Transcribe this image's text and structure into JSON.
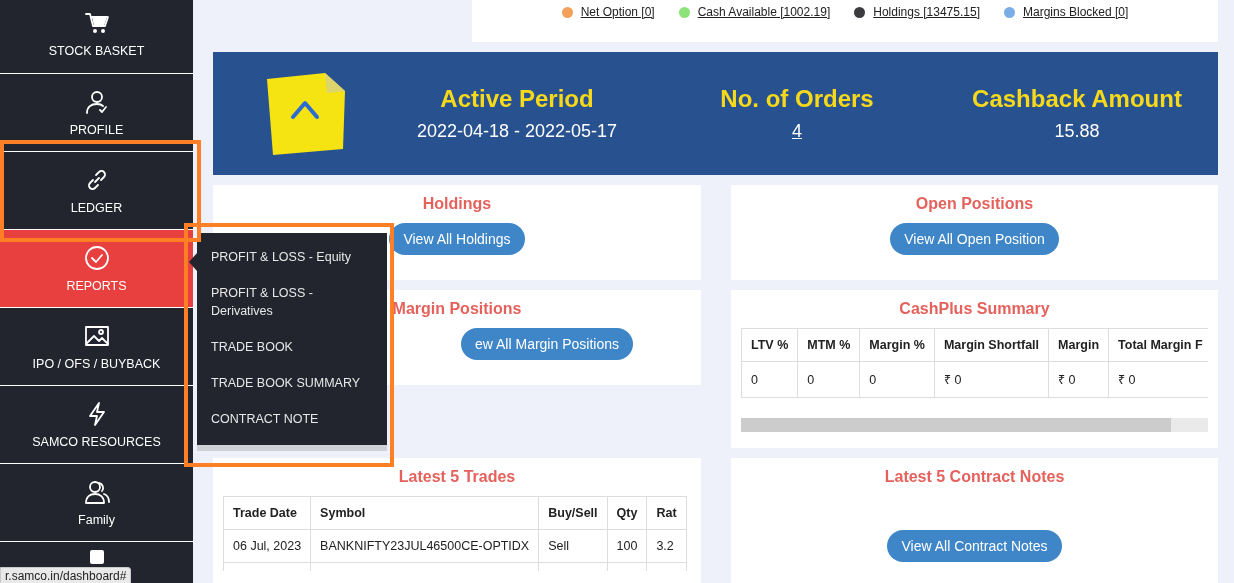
{
  "sidebar": {
    "items": [
      {
        "label": "STOCK BASKET",
        "selected": false
      },
      {
        "label": "PROFILE",
        "selected": false
      },
      {
        "label": "LEDGER",
        "selected": false
      },
      {
        "label": "REPORTS",
        "selected": true
      },
      {
        "label": "IPO / OFS / BUYBACK",
        "selected": false
      },
      {
        "label": "SAMCO RESOURCES",
        "selected": false
      },
      {
        "label": "Family",
        "selected": false
      },
      {
        "selected": false
      }
    ]
  },
  "reports_menu": {
    "items": [
      "PROFIT & LOSS - Equity",
      "PROFIT & LOSS - Derivatives",
      "TRADE BOOK",
      "TRADE BOOK SUMMARY",
      "CONTRACT NOTE"
    ]
  },
  "legend": [
    {
      "label": "Net Option [0]",
      "color": "#f5a05a"
    },
    {
      "label": "Cash Available [1002.19]",
      "color": "#8ee27a"
    },
    {
      "label": "Holdings [13475.15]",
      "color": "#3b3b40"
    },
    {
      "label": "Margins Blocked [0]",
      "color": "#7aaee6"
    }
  ],
  "banner": {
    "stats": [
      {
        "title": "Active Period",
        "value": "2022-04-18 - 2022-05-17",
        "link": false
      },
      {
        "title": "No. of Orders",
        "value": "4",
        "link": true
      },
      {
        "title": "Cashback Amount",
        "value": "15.88",
        "link": false
      }
    ]
  },
  "holdings": {
    "title": "Holdings",
    "button": "View All Holdings"
  },
  "open_positions": {
    "title": "Open Positions",
    "button": "View All Open Position"
  },
  "margin_positions": {
    "title": "Margin Positions",
    "button": "ew All Margin Positions"
  },
  "cashplus": {
    "title": "CashPlus Summary",
    "columns": [
      "LTV %",
      "MTM %",
      "Margin %",
      "Margin Shortfall",
      "Margin",
      "Total Margin F"
    ],
    "rows": [
      [
        "0",
        "0",
        "0",
        "₹ 0",
        "₹ 0",
        "₹ 0"
      ]
    ]
  },
  "trades": {
    "title": "Latest 5 Trades",
    "columns": [
      "Trade Date",
      "Symbol",
      "Buy/Sell",
      "Qty",
      "Rat"
    ],
    "rows": [
      [
        "06 Jul, 2023",
        "BANKNIFTY23JUL46500CE-OPTIDX",
        "Sell",
        "100",
        "3.2"
      ]
    ]
  },
  "contract_notes": {
    "title": "Latest 5 Contract Notes",
    "button": "View All Contract Notes"
  },
  "status_url": "r.samco.in/dashboard#"
}
